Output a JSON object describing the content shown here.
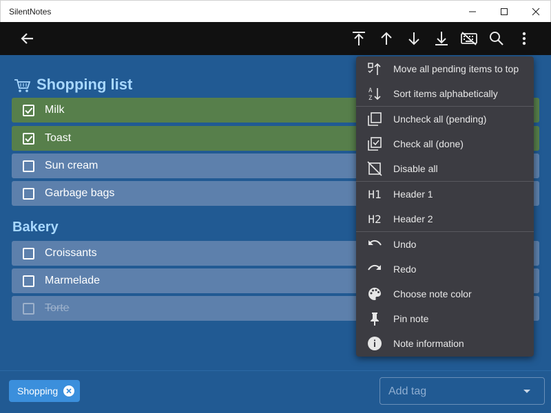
{
  "window": {
    "title": "SilentNotes"
  },
  "toolbar": {
    "buttons": [
      "back-icon",
      "move-to-top-icon",
      "arrow-up-icon",
      "arrow-down-icon",
      "move-to-bottom-icon",
      "keyboard-off-icon",
      "search-icon",
      "more-vert-icon"
    ]
  },
  "note": {
    "color": "#215a93",
    "sections": [
      {
        "header": "Shopping list",
        "items": [
          {
            "label": "Milk",
            "state": "done"
          },
          {
            "label": "Toast",
            "state": "done"
          },
          {
            "label": "Sun cream",
            "state": "pending"
          },
          {
            "label": "Garbage bags",
            "state": "pending"
          }
        ]
      },
      {
        "header": "Bakery",
        "items": [
          {
            "label": "Croissants",
            "state": "pending"
          },
          {
            "label": "Marmelade",
            "state": "pending"
          },
          {
            "label": "Torte",
            "state": "disabled"
          }
        ]
      }
    ]
  },
  "menu": {
    "items": [
      {
        "label": "Move all pending items to top",
        "icon": "checklist-up-icon"
      },
      {
        "label": "Sort items alphabetically",
        "icon": "sort-az-icon"
      },
      {
        "label": "Uncheck all (pending)",
        "icon": "uncheck-all-icon"
      },
      {
        "label": "Check all (done)",
        "icon": "check-all-icon"
      },
      {
        "label": "Disable all",
        "icon": "disable-all-icon"
      },
      {
        "label": "Header 1",
        "icon": "h1-icon",
        "glyph": "H1"
      },
      {
        "label": "Header 2",
        "icon": "h2-icon",
        "glyph": "H2"
      },
      {
        "label": "Undo",
        "icon": "undo-icon"
      },
      {
        "label": "Redo",
        "icon": "redo-icon"
      },
      {
        "label": "Choose note color",
        "icon": "palette-icon"
      },
      {
        "label": "Pin note",
        "icon": "pin-icon"
      },
      {
        "label": "Note information",
        "icon": "info-icon"
      }
    ]
  },
  "tags": {
    "chips": [
      {
        "label": "Shopping"
      }
    ],
    "input_placeholder": "Add tag"
  }
}
